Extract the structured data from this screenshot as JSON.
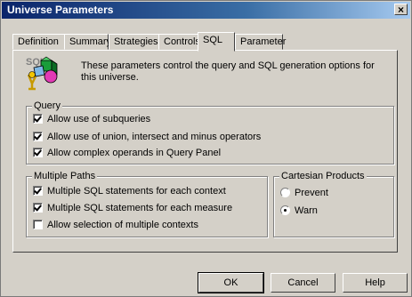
{
  "window": {
    "title": "Universe Parameters"
  },
  "tabs": [
    {
      "label": "Definition"
    },
    {
      "label": "Summary"
    },
    {
      "label": "Strategies"
    },
    {
      "label": "Controls"
    },
    {
      "label": "SQL",
      "active": true
    },
    {
      "label": "Parameter"
    }
  ],
  "intro": {
    "logo_text": "SQL",
    "text": "These parameters control the query and SQL generation options for this universe."
  },
  "query": {
    "title": "Query",
    "options": [
      {
        "label": "Allow use of subqueries",
        "checked": true
      },
      {
        "label": "Allow use of union, intersect and minus operators",
        "checked": true
      },
      {
        "label": "Allow complex operands in Query Panel",
        "checked": true
      }
    ]
  },
  "multiple_paths": {
    "title": "Multiple Paths",
    "options": [
      {
        "label": "Multiple SQL statements for each context",
        "checked": true
      },
      {
        "label": "Multiple SQL statements for each measure",
        "checked": true
      },
      {
        "label": "Allow selection of multiple contexts",
        "checked": false
      }
    ]
  },
  "cartesian": {
    "title": "Cartesian Products",
    "options": [
      {
        "label": "Prevent",
        "selected": false
      },
      {
        "label": "Warn",
        "selected": true
      }
    ]
  },
  "buttons": {
    "ok": "OK",
    "cancel": "Cancel",
    "help": "Help"
  },
  "colors": {
    "face": "#d4d0c8",
    "title_start": "#0a246a",
    "title_end": "#a6caf0"
  },
  "icons": [
    "close-icon",
    "sql-logo-icon"
  ]
}
